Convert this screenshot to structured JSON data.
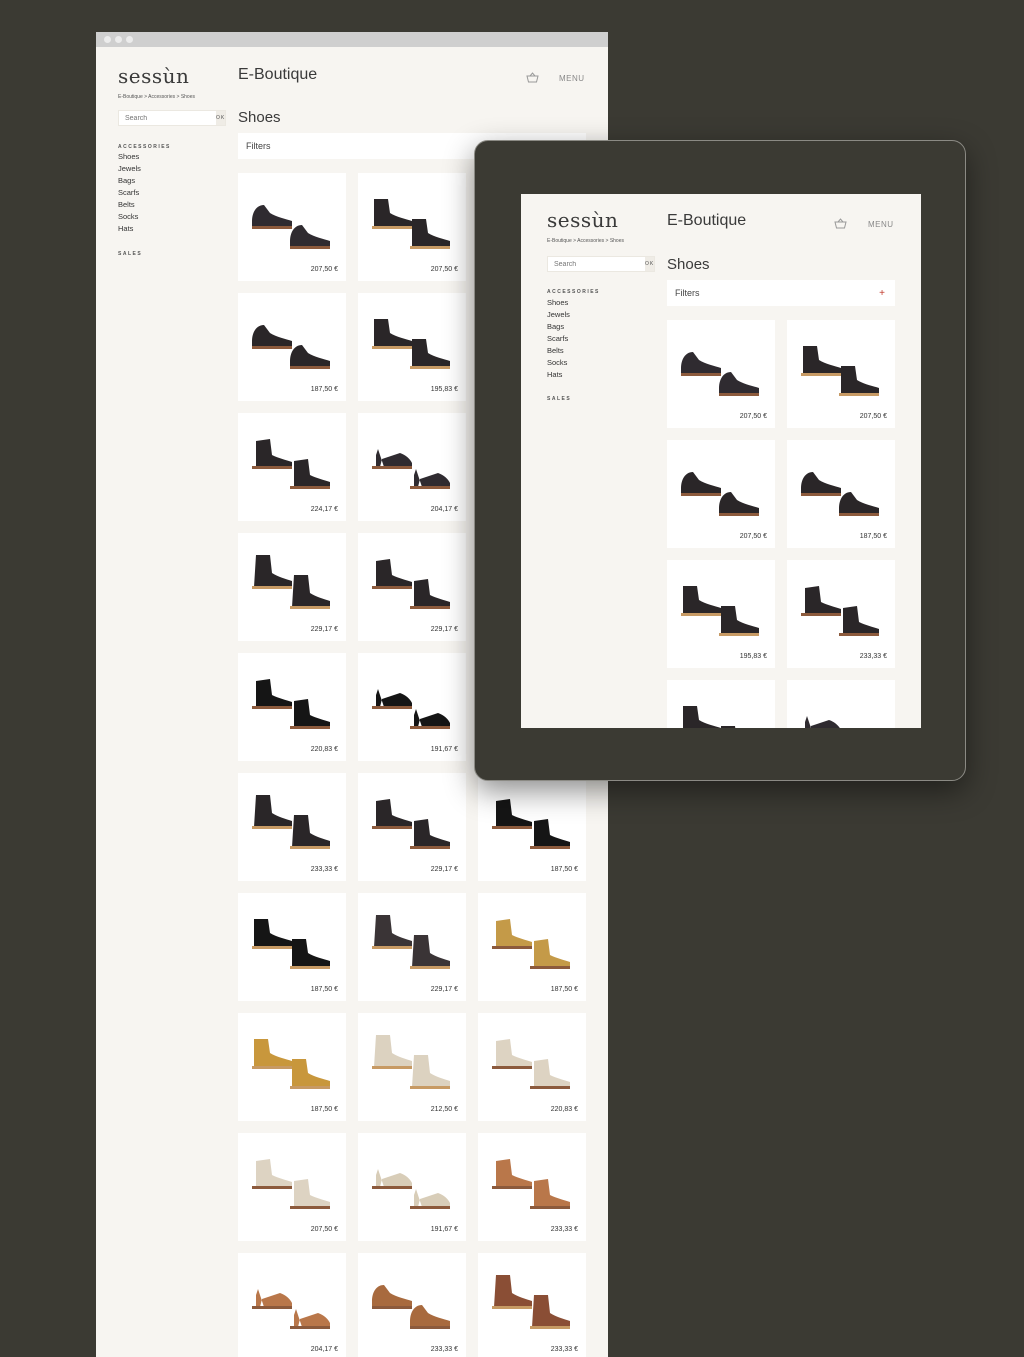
{
  "brand": {
    "logo": "sessùn"
  },
  "breadcrumb": "E-Boutique > Accessories > Shoes",
  "header": {
    "title": "E-Boutique",
    "menu_label": "MENU",
    "basket_icon": "basket-icon"
  },
  "search": {
    "placeholder": "Search",
    "button_label": "OK"
  },
  "sidebar": {
    "heading": "ACCESSORIES",
    "items": [
      "Shoes",
      "Jewels",
      "Bags",
      "Scarfs",
      "Belts",
      "Socks",
      "Hats"
    ],
    "sales_label": "SALES"
  },
  "page": {
    "title": "Shoes",
    "filters_label": "Filters",
    "filters_icon": "+"
  },
  "colors": {
    "background": "#3b3a33",
    "page": "#f7f5f1",
    "card": "#ffffff",
    "accent": "#c0392b"
  },
  "desktop_products": [
    {
      "price": "207,50 €",
      "color": "#2f2b30",
      "style": "oxford"
    },
    {
      "price": "207,50 €",
      "color": "#2a2628",
      "style": "chelsea"
    },
    {
      "price": "",
      "color": "#2a2628",
      "style": "oxford"
    },
    {
      "price": "187,50 €",
      "color": "#2a2628",
      "style": "oxford"
    },
    {
      "price": "195,83 €",
      "color": "#2a2628",
      "style": "chelsea"
    },
    {
      "price": "",
      "color": "#2a2628",
      "style": "chelsea"
    },
    {
      "price": "224,17 €",
      "color": "#2a2628",
      "style": "ankle"
    },
    {
      "price": "204,17 €",
      "color": "#2f2b30",
      "style": "heel"
    },
    {
      "price": "",
      "color": "#2a2628",
      "style": "ankle"
    },
    {
      "price": "229,17 €",
      "color": "#2a2628",
      "style": "lace"
    },
    {
      "price": "229,17 €",
      "color": "#2a2628",
      "style": "ankle"
    },
    {
      "price": "",
      "color": "#2a2628",
      "style": "ankle"
    },
    {
      "price": "220,83 €",
      "color": "#151515",
      "style": "ankle"
    },
    {
      "price": "191,67 €",
      "color": "#151515",
      "style": "heel"
    },
    {
      "price": "",
      "color": "#151515",
      "style": "ankle"
    },
    {
      "price": "233,33 €",
      "color": "#2a2628",
      "style": "lace"
    },
    {
      "price": "229,17 €",
      "color": "#2a2628",
      "style": "ankle"
    },
    {
      "price": "187,50 €",
      "color": "#151515",
      "style": "ankle"
    },
    {
      "price": "187,50 €",
      "color": "#151515",
      "style": "chelsea"
    },
    {
      "price": "229,17 €",
      "color": "#3a3436",
      "style": "lace"
    },
    {
      "price": "187,50 €",
      "color": "#c49a48",
      "style": "ankle"
    },
    {
      "price": "187,50 €",
      "color": "#c8973c",
      "style": "chelsea"
    },
    {
      "price": "212,50 €",
      "color": "#dcd2c0",
      "style": "lace"
    },
    {
      "price": "220,83 €",
      "color": "#ddd3c2",
      "style": "ankle"
    },
    {
      "price": "207,50 €",
      "color": "#ddd3c2",
      "style": "ankle"
    },
    {
      "price": "191,67 €",
      "color": "#d8cdb8",
      "style": "heel"
    },
    {
      "price": "233,33 €",
      "color": "#b9774a",
      "style": "ankle"
    },
    {
      "price": "204,17 €",
      "color": "#b9774a",
      "style": "heel"
    },
    {
      "price": "233,33 €",
      "color": "#a86a3e",
      "style": "oxford"
    },
    {
      "price": "233,33 €",
      "color": "#8a4e35",
      "style": "lace"
    }
  ],
  "tablet_products": [
    {
      "price": "207,50 €",
      "color": "#2f2b30",
      "style": "oxford"
    },
    {
      "price": "207,50 €",
      "color": "#2a2628",
      "style": "chelsea"
    },
    {
      "price": "207,50 €",
      "color": "#2a2628",
      "style": "oxford"
    },
    {
      "price": "187,50 €",
      "color": "#2a2628",
      "style": "oxford"
    },
    {
      "price": "195,83 €",
      "color": "#2a2628",
      "style": "chelsea"
    },
    {
      "price": "233,33 €",
      "color": "#2a2628",
      "style": "ankle"
    },
    {
      "price": "",
      "color": "#2a2628",
      "style": "chelsea"
    },
    {
      "price": "",
      "color": "#2f2b30",
      "style": "heel"
    }
  ]
}
